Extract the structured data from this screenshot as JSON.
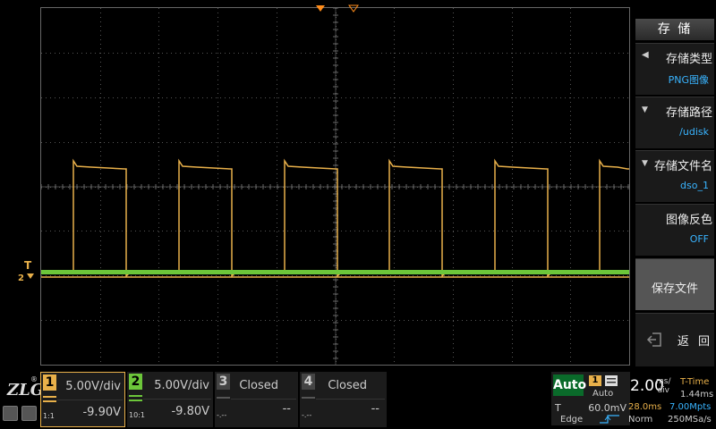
{
  "colors": {
    "ch1": "#e8b04a",
    "ch2": "#6cc63a",
    "accent": "#39b4ff",
    "trigger_marker": "#ff8c1a"
  },
  "menu": {
    "title": "存 储",
    "items": [
      {
        "label": "存储类型",
        "value": "PNG图像",
        "arrow": "chevron-left-icon"
      },
      {
        "label": "存储路径",
        "value": "/udisk",
        "arrow": "chevron-down-icon"
      },
      {
        "label": "存储文件名",
        "value": "dso_1",
        "arrow": "chevron-down-icon"
      },
      {
        "label": "图像反色",
        "value": "OFF"
      },
      {
        "label": "保存文件"
      },
      {
        "label": "返 回"
      }
    ]
  },
  "markers": {
    "trigger_level": "T",
    "ch2_ground": "2"
  },
  "channels": [
    {
      "num": "1",
      "scale": "5.00V/div",
      "offset": "-9.90V",
      "probe": "1:1",
      "state": "on"
    },
    {
      "num": "2",
      "scale": "5.00V/div",
      "offset": "-9.80V",
      "probe": "10:1",
      "state": "on"
    },
    {
      "num": "3",
      "scale": "Closed",
      "offset": "--",
      "probe": "-.--",
      "state": "closed"
    },
    {
      "num": "4",
      "scale": "Closed",
      "offset": "--",
      "probe": "-.--",
      "state": "closed"
    }
  ],
  "trigger": {
    "mode": "Auto",
    "source": "1",
    "sweep": "Auto",
    "label": "T",
    "level": "60.0mV",
    "type": "Edge"
  },
  "timebase": {
    "scale": "2.00",
    "unit_top": "ms/",
    "unit_bottom": "div",
    "title": "T-Time",
    "time": "1.44ms",
    "delay": "28.0ms",
    "memory": "7.00Mpts",
    "acq_mode": "Norm",
    "sample_rate": "250MSa/s"
  },
  "logo": {
    "text": "ZLG",
    "reg": "®"
  }
}
